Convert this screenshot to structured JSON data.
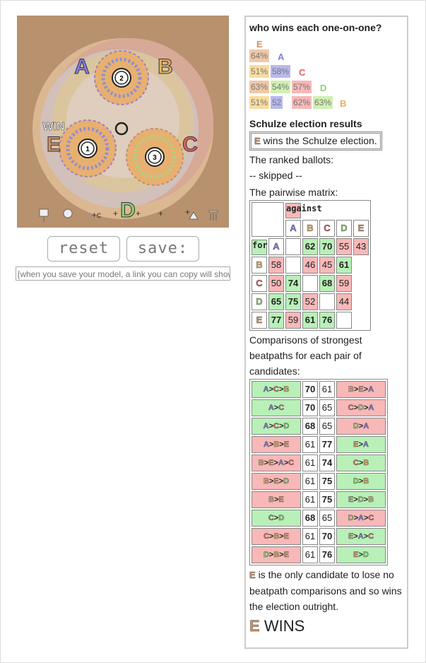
{
  "sim": {
    "candidates": [
      {
        "label": "A",
        "color": "#8080e0"
      },
      {
        "label": "B",
        "color": "#e0b060"
      },
      {
        "label": "C",
        "color": "#e06060"
      },
      {
        "label": "D",
        "color": "#90d070"
      },
      {
        "label": "E",
        "color": "#d09060"
      }
    ],
    "voter_labels": [
      "2",
      "1",
      "3"
    ],
    "win_label": "WIN",
    "toolbar_icons": [
      "ballot-box-icon",
      "gear-icon",
      "add-candidate-icon",
      "add-voter-icon",
      "add-voter-group-icon",
      "add-grid-icon",
      "add-triangle-icon",
      "columns-icon"
    ]
  },
  "buttons": {
    "reset": "reset",
    "save": "save:"
  },
  "save_hint": "[when you save your model, a link you can copy will show",
  "panel": {
    "heading": "who wins each one-on-one?",
    "oneonone": [
      {
        "row": "A",
        "cells": [
          {
            "v": "64",
            "u": "%",
            "c": "E",
            "col": "#f0c8a8"
          }
        ]
      },
      {
        "row": "C",
        "cells": [
          {
            "v": "51",
            "u": "%",
            "c": "E",
            "col": "#f8dca0"
          },
          {
            "v": "58",
            "u": "%",
            "c": "A",
            "col": "#b8b8f0"
          }
        ]
      },
      {
        "row": "D",
        "cells": [
          {
            "v": "63",
            "u": "%",
            "c": "E",
            "col": "#f0c8a8"
          },
          {
            "v": "54",
            "u": "%",
            "c": "C",
            "col": "#d0f0b0"
          },
          {
            "v": "57",
            "u": "%",
            "c": "C",
            "col": "#f8b8b8"
          }
        ]
      },
      {
        "row": "B",
        "cells": [
          {
            "v": "51",
            "u": "%",
            "c": "E",
            "col": "#f8dca0"
          },
          {
            "v": "52",
            "u": "",
            "c": "A",
            "col": "#b8b8f0"
          },
          {
            "v": "62",
            "u": "%",
            "c": "C",
            "col": "#f8b8b8"
          },
          {
            "v": "63",
            "u": "%",
            "c": "D",
            "col": "#d0f0b0"
          }
        ]
      }
    ],
    "schulze_title": "Schulze election results",
    "winner_text": "wins the Schulze election.",
    "winner": "E",
    "ballots_label": "The ranked ballots:",
    "ballots_value": "-- skipped --",
    "matrix_label": "The pairwise matrix:",
    "against_label": "against",
    "for_label": "for",
    "matrix": {
      "labels": [
        "A",
        "B",
        "C",
        "D",
        "E"
      ],
      "rows": [
        [
          "",
          "62",
          "70",
          "55",
          "43"
        ],
        [
          "58",
          "",
          "46",
          "45",
          "61"
        ],
        [
          "50",
          "74",
          "",
          "68",
          "59"
        ],
        [
          "65",
          "75",
          "52",
          "",
          "44"
        ],
        [
          "77",
          "59",
          "61",
          "76",
          ""
        ]
      ]
    },
    "beatpath_label": "Comparisons of strongest beatpaths for each pair of candidates:",
    "beatpaths": [
      {
        "l": "A>C>B",
        "a": "70",
        "b": "61",
        "r": "B>E>A",
        "lw": true
      },
      {
        "l": "A>C",
        "a": "70",
        "b": "65",
        "r": "C>D>A",
        "lw": true
      },
      {
        "l": "A>C>D",
        "a": "68",
        "b": "65",
        "r": "D>A",
        "lw": true
      },
      {
        "l": "A>B>E",
        "a": "61",
        "b": "77",
        "r": "E>A",
        "lw": false
      },
      {
        "l": "B>E>A>C",
        "a": "61",
        "b": "74",
        "r": "C>B",
        "lw": false
      },
      {
        "l": "B>E>D",
        "a": "61",
        "b": "75",
        "r": "D>B",
        "lw": false
      },
      {
        "l": "B>E",
        "a": "61",
        "b": "75",
        "r": "E>D>B",
        "lw": false
      },
      {
        "l": "C>D",
        "a": "68",
        "b": "65",
        "r": "D>A>C",
        "lw": true
      },
      {
        "l": "C>B>E",
        "a": "61",
        "b": "70",
        "r": "E>A>C",
        "lw": false
      },
      {
        "l": "D>B>E",
        "a": "61",
        "b": "76",
        "r": "E>D",
        "lw": false
      }
    ],
    "conclusion": "is the only candidate to lose no beatpath comparisons and so wins the election outright.",
    "final": "WINS"
  }
}
